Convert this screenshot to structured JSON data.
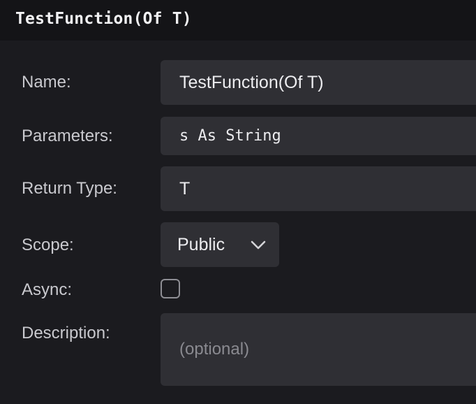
{
  "header": {
    "title": "TestFunction(Of T)"
  },
  "form": {
    "name": {
      "label": "Name:",
      "value": "TestFunction(Of T)"
    },
    "parameters": {
      "label": "Parameters:",
      "value": "s As String"
    },
    "return_type": {
      "label": "Return Type:",
      "value": "T"
    },
    "scope": {
      "label": "Scope:",
      "selected": "Public"
    },
    "async": {
      "label": "Async:",
      "checked": false
    },
    "description": {
      "label": "Description:",
      "placeholder": "(optional)",
      "value": ""
    }
  },
  "icons": {
    "scope_dropdown": "chevron-down-icon"
  },
  "colors": {
    "background": "#1b1b1f",
    "header_background": "#141417",
    "field_background": "#2f2f34",
    "label_text": "#c9c9ce",
    "value_text": "#ececef",
    "placeholder_text": "#8a8a90"
  }
}
